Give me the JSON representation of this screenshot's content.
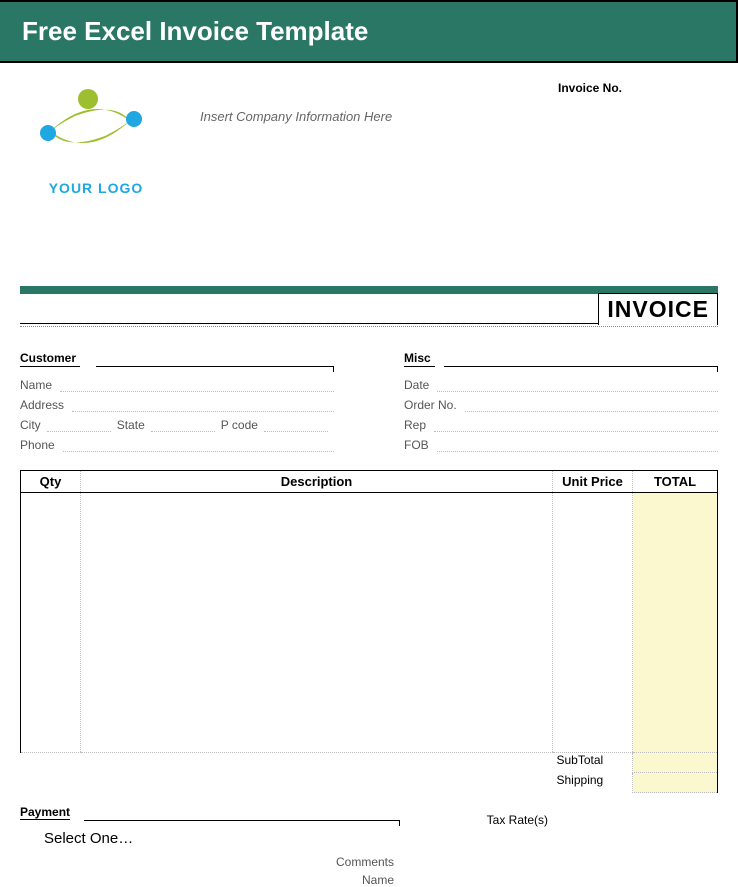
{
  "banner": {
    "title": "Free Excel Invoice Template"
  },
  "header": {
    "logo_text": "YOUR LOGO",
    "company_info_placeholder": "Insert Company Information Here",
    "invoice_no_label": "Invoice No.",
    "invoice_title": "INVOICE"
  },
  "customer": {
    "heading": "Customer",
    "name_label": "Name",
    "address_label": "Address",
    "city_label": "City",
    "state_label": "State",
    "pcode_label": "P code",
    "phone_label": "Phone"
  },
  "misc": {
    "heading": "Misc",
    "date_label": "Date",
    "orderno_label": "Order No.",
    "rep_label": "Rep",
    "fob_label": "FOB"
  },
  "table": {
    "headers": {
      "qty": "Qty",
      "description": "Description",
      "unitprice": "Unit Price",
      "total": "TOTAL"
    }
  },
  "totals": {
    "subtotal_label": "SubTotal",
    "shipping_label": "Shipping",
    "taxrate_label": "Tax Rate(s)"
  },
  "payment": {
    "heading": "Payment",
    "select_text": "Select One…",
    "comments_label": "Comments",
    "name_label": "Name"
  }
}
